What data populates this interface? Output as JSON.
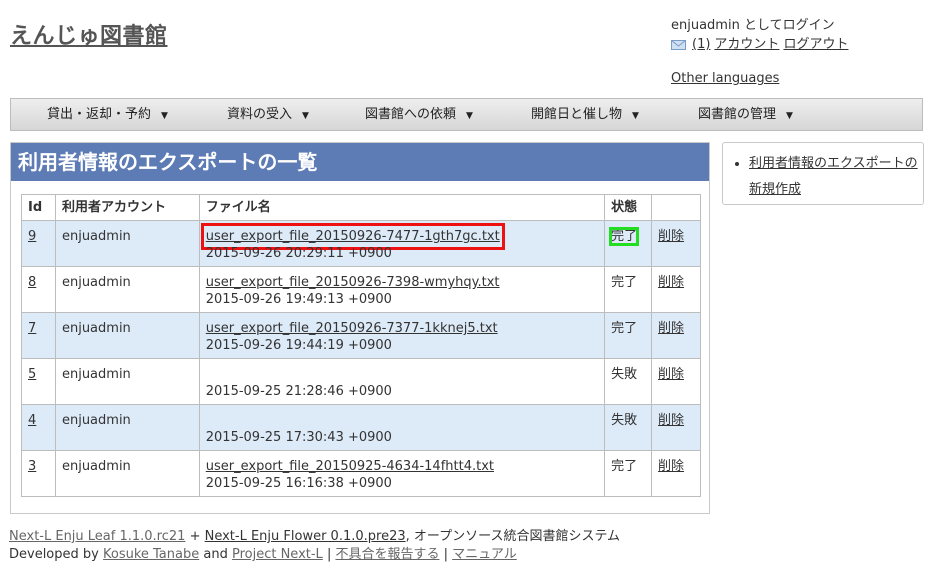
{
  "site": {
    "title": "えんじゅ図書館"
  },
  "login": {
    "status": "enjuadmin としてログイン",
    "messages": "(1)",
    "account": "アカウント",
    "logout": "ログアウト",
    "other_languages": "Other languages"
  },
  "menu": [
    {
      "label": "貸出・返却・予約"
    },
    {
      "label": "資料の受入"
    },
    {
      "label": "図書館への依頼"
    },
    {
      "label": "開館日と催し物"
    },
    {
      "label": "図書館の管理"
    }
  ],
  "page": {
    "title": "利用者情報のエクスポートの一覧"
  },
  "table": {
    "headers": {
      "id": "Id",
      "account": "利用者アカウント",
      "file": "ファイル名",
      "state": "状態"
    },
    "rows": [
      {
        "id": "9",
        "account": "enjuadmin",
        "file": "user_export_file_20150926-7477-1gth7gc.txt",
        "date": "2015-09-26 20:29:11 +0900",
        "state": "完了",
        "delete": "削除"
      },
      {
        "id": "8",
        "account": "enjuadmin",
        "file": "user_export_file_20150926-7398-wmyhqy.txt",
        "date": "2015-09-26 19:49:13 +0900",
        "state": "完了",
        "delete": "削除"
      },
      {
        "id": "7",
        "account": "enjuadmin",
        "file": "user_export_file_20150926-7377-1kknej5.txt",
        "date": "2015-09-26 19:44:19 +0900",
        "state": "完了",
        "delete": "削除"
      },
      {
        "id": "5",
        "account": "enjuadmin",
        "file": "",
        "date": "2015-09-25 21:28:46 +0900",
        "state": "失敗",
        "delete": "削除"
      },
      {
        "id": "4",
        "account": "enjuadmin",
        "file": "",
        "date": "2015-09-25 17:30:43 +0900",
        "state": "失敗",
        "delete": "削除"
      },
      {
        "id": "3",
        "account": "enjuadmin",
        "file": "user_export_file_20150925-4634-14fhtt4.txt",
        "date": "2015-09-25 16:16:38 +0900",
        "state": "完了",
        "delete": "削除"
      }
    ]
  },
  "sidebar": {
    "new_link": "利用者情報のエクスポートの新規作成"
  },
  "footer": {
    "leaf": "Next-L Enju Leaf 1.1.0.rc21",
    "plus": " + ",
    "flower": "Next-L Enju Flower 0.1.0.pre23",
    "system": ", オープンソース統合図書館システム",
    "developed_by": "Developed by ",
    "author": "Kosuke Tanabe",
    "and": " and ",
    "project": "Project Next-L",
    "sep": " | ",
    "report": "不具合を報告する",
    "manual": "マニュアル"
  },
  "colors": {
    "header_bg": "#5d7bb4",
    "row_alt": "#ddeaf8",
    "highlight_red": "#ee1111",
    "highlight_green": "#22dd22"
  },
  "icons": {
    "mail": "mail-icon",
    "caret": "caret-down-icon"
  }
}
